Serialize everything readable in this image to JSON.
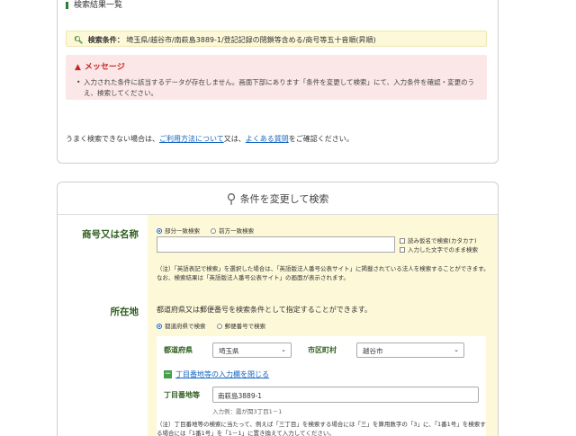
{
  "result": {
    "title": "検索結果一覧",
    "search_condition_label": "検索条件：",
    "search_condition_value": "埼玉県/越谷市/南萩島3889-1/登記記録の閉鎖等含める/商号等五十音順(昇順)",
    "message_heading": "メッセージ",
    "message_text": "入力された条件に該当するデータが存在しません。画面下部にあります「条件を変更して検索」にて、入力条件を確認・変更のうえ、検索してください。",
    "help_prefix": "うまく検索できない場合は、",
    "help_link1": "ご利用方法について",
    "help_middle": "又は、",
    "help_link2": "よくある質問",
    "help_suffix": "をご確認ください。"
  },
  "search": {
    "heading": "条件を変更して検索",
    "name": {
      "label": "商号又は名称",
      "radio_partial": "部分一致検索",
      "radio_prefix": "前方一致検索",
      "input_value": "",
      "check_kana": "読み仮名で検索(カタカナ)",
      "check_exact": "入力した文字でのまま検索",
      "note": "（注）「英語表記で検索」を選択した場合は、「英語版法人番号公表サイト」に掲載されている法人を検索することができます。なお、検索結果は「英語版法人番号公表サイト」の画面が表示されます。"
    },
    "location": {
      "label": "所在地",
      "intro": "都道府県又は郵便番号を検索条件として指定することができます。",
      "radio_pref": "都道府県で検索",
      "radio_zip": "郵便番号で検索",
      "pref_label": "都道府県",
      "pref_value": "埼玉県",
      "city_label": "市区町村",
      "city_value": "越谷市",
      "toggle_link": "丁目番地等の入力欄を閉じる",
      "chome_label": "丁目番地等",
      "chome_value": "南萩島3889-1",
      "chome_hint": "入力例：霞が関3丁目1－1",
      "note": "（注）丁目番地等の検索に当たって、例えば「三丁目」を検索する場合には「三」を算用数字の「3」に、「1番1号」を検索する場合には「1番1号」を「1－1」に置き換えて入力してください。"
    }
  }
}
